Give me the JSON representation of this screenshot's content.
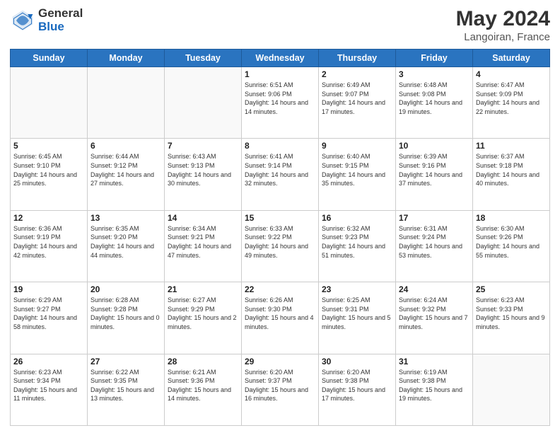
{
  "header": {
    "logo_general": "General",
    "logo_blue": "Blue",
    "main_title": "May 2024",
    "subtitle": "Langoiran, France"
  },
  "days_of_week": [
    "Sunday",
    "Monday",
    "Tuesday",
    "Wednesday",
    "Thursday",
    "Friday",
    "Saturday"
  ],
  "weeks": [
    [
      {
        "day": "",
        "sunrise": "",
        "sunset": "",
        "daylight": ""
      },
      {
        "day": "",
        "sunrise": "",
        "sunset": "",
        "daylight": ""
      },
      {
        "day": "",
        "sunrise": "",
        "sunset": "",
        "daylight": ""
      },
      {
        "day": "1",
        "sunrise": "Sunrise: 6:51 AM",
        "sunset": "Sunset: 9:06 PM",
        "daylight": "Daylight: 14 hours and 14 minutes."
      },
      {
        "day": "2",
        "sunrise": "Sunrise: 6:49 AM",
        "sunset": "Sunset: 9:07 PM",
        "daylight": "Daylight: 14 hours and 17 minutes."
      },
      {
        "day": "3",
        "sunrise": "Sunrise: 6:48 AM",
        "sunset": "Sunset: 9:08 PM",
        "daylight": "Daylight: 14 hours and 19 minutes."
      },
      {
        "day": "4",
        "sunrise": "Sunrise: 6:47 AM",
        "sunset": "Sunset: 9:09 PM",
        "daylight": "Daylight: 14 hours and 22 minutes."
      }
    ],
    [
      {
        "day": "5",
        "sunrise": "Sunrise: 6:45 AM",
        "sunset": "Sunset: 9:10 PM",
        "daylight": "Daylight: 14 hours and 25 minutes."
      },
      {
        "day": "6",
        "sunrise": "Sunrise: 6:44 AM",
        "sunset": "Sunset: 9:12 PM",
        "daylight": "Daylight: 14 hours and 27 minutes."
      },
      {
        "day": "7",
        "sunrise": "Sunrise: 6:43 AM",
        "sunset": "Sunset: 9:13 PM",
        "daylight": "Daylight: 14 hours and 30 minutes."
      },
      {
        "day": "8",
        "sunrise": "Sunrise: 6:41 AM",
        "sunset": "Sunset: 9:14 PM",
        "daylight": "Daylight: 14 hours and 32 minutes."
      },
      {
        "day": "9",
        "sunrise": "Sunrise: 6:40 AM",
        "sunset": "Sunset: 9:15 PM",
        "daylight": "Daylight: 14 hours and 35 minutes."
      },
      {
        "day": "10",
        "sunrise": "Sunrise: 6:39 AM",
        "sunset": "Sunset: 9:16 PM",
        "daylight": "Daylight: 14 hours and 37 minutes."
      },
      {
        "day": "11",
        "sunrise": "Sunrise: 6:37 AM",
        "sunset": "Sunset: 9:18 PM",
        "daylight": "Daylight: 14 hours and 40 minutes."
      }
    ],
    [
      {
        "day": "12",
        "sunrise": "Sunrise: 6:36 AM",
        "sunset": "Sunset: 9:19 PM",
        "daylight": "Daylight: 14 hours and 42 minutes."
      },
      {
        "day": "13",
        "sunrise": "Sunrise: 6:35 AM",
        "sunset": "Sunset: 9:20 PM",
        "daylight": "Daylight: 14 hours and 44 minutes."
      },
      {
        "day": "14",
        "sunrise": "Sunrise: 6:34 AM",
        "sunset": "Sunset: 9:21 PM",
        "daylight": "Daylight: 14 hours and 47 minutes."
      },
      {
        "day": "15",
        "sunrise": "Sunrise: 6:33 AM",
        "sunset": "Sunset: 9:22 PM",
        "daylight": "Daylight: 14 hours and 49 minutes."
      },
      {
        "day": "16",
        "sunrise": "Sunrise: 6:32 AM",
        "sunset": "Sunset: 9:23 PM",
        "daylight": "Daylight: 14 hours and 51 minutes."
      },
      {
        "day": "17",
        "sunrise": "Sunrise: 6:31 AM",
        "sunset": "Sunset: 9:24 PM",
        "daylight": "Daylight: 14 hours and 53 minutes."
      },
      {
        "day": "18",
        "sunrise": "Sunrise: 6:30 AM",
        "sunset": "Sunset: 9:26 PM",
        "daylight": "Daylight: 14 hours and 55 minutes."
      }
    ],
    [
      {
        "day": "19",
        "sunrise": "Sunrise: 6:29 AM",
        "sunset": "Sunset: 9:27 PM",
        "daylight": "Daylight: 14 hours and 58 minutes."
      },
      {
        "day": "20",
        "sunrise": "Sunrise: 6:28 AM",
        "sunset": "Sunset: 9:28 PM",
        "daylight": "Daylight: 15 hours and 0 minutes."
      },
      {
        "day": "21",
        "sunrise": "Sunrise: 6:27 AM",
        "sunset": "Sunset: 9:29 PM",
        "daylight": "Daylight: 15 hours and 2 minutes."
      },
      {
        "day": "22",
        "sunrise": "Sunrise: 6:26 AM",
        "sunset": "Sunset: 9:30 PM",
        "daylight": "Daylight: 15 hours and 4 minutes."
      },
      {
        "day": "23",
        "sunrise": "Sunrise: 6:25 AM",
        "sunset": "Sunset: 9:31 PM",
        "daylight": "Daylight: 15 hours and 5 minutes."
      },
      {
        "day": "24",
        "sunrise": "Sunrise: 6:24 AM",
        "sunset": "Sunset: 9:32 PM",
        "daylight": "Daylight: 15 hours and 7 minutes."
      },
      {
        "day": "25",
        "sunrise": "Sunrise: 6:23 AM",
        "sunset": "Sunset: 9:33 PM",
        "daylight": "Daylight: 15 hours and 9 minutes."
      }
    ],
    [
      {
        "day": "26",
        "sunrise": "Sunrise: 6:23 AM",
        "sunset": "Sunset: 9:34 PM",
        "daylight": "Daylight: 15 hours and 11 minutes."
      },
      {
        "day": "27",
        "sunrise": "Sunrise: 6:22 AM",
        "sunset": "Sunset: 9:35 PM",
        "daylight": "Daylight: 15 hours and 13 minutes."
      },
      {
        "day": "28",
        "sunrise": "Sunrise: 6:21 AM",
        "sunset": "Sunset: 9:36 PM",
        "daylight": "Daylight: 15 hours and 14 minutes."
      },
      {
        "day": "29",
        "sunrise": "Sunrise: 6:20 AM",
        "sunset": "Sunset: 9:37 PM",
        "daylight": "Daylight: 15 hours and 16 minutes."
      },
      {
        "day": "30",
        "sunrise": "Sunrise: 6:20 AM",
        "sunset": "Sunset: 9:38 PM",
        "daylight": "Daylight: 15 hours and 17 minutes."
      },
      {
        "day": "31",
        "sunrise": "Sunrise: 6:19 AM",
        "sunset": "Sunset: 9:38 PM",
        "daylight": "Daylight: 15 hours and 19 minutes."
      },
      {
        "day": "",
        "sunrise": "",
        "sunset": "",
        "daylight": ""
      }
    ]
  ]
}
